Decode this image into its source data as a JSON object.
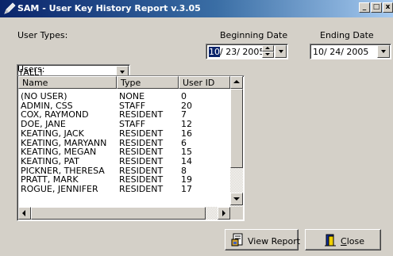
{
  "window": {
    "title": "SAM - User Key History Report v.3.05",
    "controls": {
      "minimize": "_",
      "maximize": "□",
      "close": "x"
    }
  },
  "filters": {
    "user_types_label": "User Types:",
    "user_types_value": "[ALL]",
    "beginning_date_label": "Beginning Date",
    "beginning_date": {
      "month": "10",
      "rest": "/ 23/ 2005"
    },
    "ending_date_label": "Ending Date",
    "ending_date": "10/ 24/ 2005"
  },
  "users": {
    "label": "Users:",
    "columns": [
      "Name",
      "Type",
      "User ID"
    ],
    "rows": [
      {
        "name": "(NO USER)",
        "type": "NONE",
        "id": "0"
      },
      {
        "name": "ADMIN, CSS",
        "type": "STAFF",
        "id": "20"
      },
      {
        "name": "COX, RAYMOND",
        "type": "RESIDENT",
        "id": "7"
      },
      {
        "name": "DOE, JANE",
        "type": "STAFF",
        "id": "12"
      },
      {
        "name": "KEATING, JACK",
        "type": "RESIDENT",
        "id": "16"
      },
      {
        "name": "KEATING, MARYANN",
        "type": "RESIDENT",
        "id": "6"
      },
      {
        "name": "KEATING, MEGAN",
        "type": "RESIDENT",
        "id": "15"
      },
      {
        "name": "KEATING, PAT",
        "type": "RESIDENT",
        "id": "14"
      },
      {
        "name": "PICKNER, THERESA",
        "type": "RESIDENT",
        "id": "8"
      },
      {
        "name": "PRATT, MARK",
        "type": "RESIDENT",
        "id": "19"
      },
      {
        "name": "ROGUE, JENNIFER",
        "type": "RESIDENT",
        "id": "17"
      }
    ]
  },
  "buttons": {
    "view_report": "View Report",
    "close": "Close"
  },
  "colors": {
    "title_start": "#0a246a",
    "title_end": "#a6caf0",
    "face": "#d4d0c8",
    "selection": "#0a246a"
  },
  "icons": [
    "app-pen-icon",
    "report-icon",
    "door-exit-icon"
  ]
}
